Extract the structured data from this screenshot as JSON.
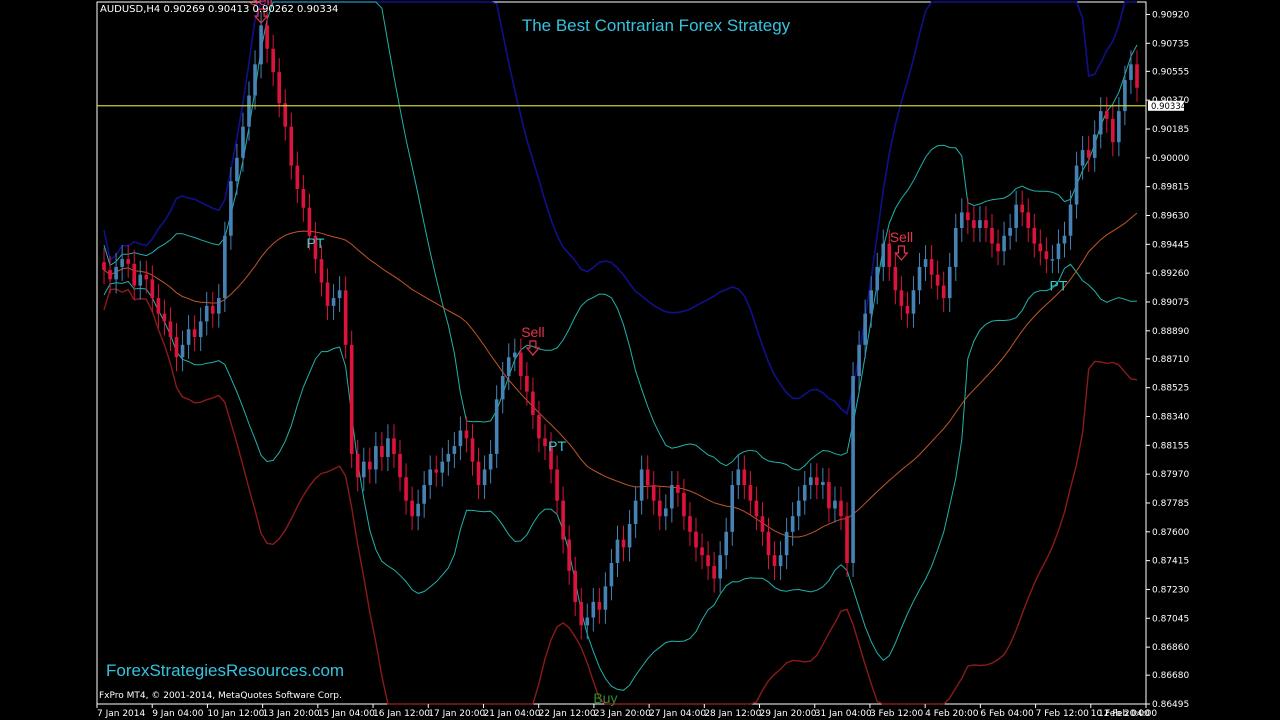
{
  "header": {
    "symbol_info": "AUDUSD,H4  0.90269 0.90413 0.90262 0.90334",
    "title": "The Best Contrarian Forex Strategy",
    "website": "ForexStrategiesResources.com",
    "copyright": "FxPro MT4, © 2001-2014, MetaQuotes Software Corp."
  },
  "colors": {
    "background": "#000000",
    "bull_candle": "#4682b4",
    "bear_candle": "#dc143c",
    "inner_band": "#20b2aa",
    "outer_band_upper": "#10108c",
    "outer_band_lower": "#8b1a1a",
    "middle_line": "#c0562a",
    "price_line": "#cccc33",
    "sell_signal": "#e8334d",
    "buy_signal": "#2e8b2e",
    "pt_label": "#30d0d0",
    "axis_text": "#ffffff"
  },
  "chart_data": {
    "type": "candlestick",
    "symbol": "AUDUSD",
    "timeframe": "H4",
    "ylim": [
      0.86495,
      0.91
    ],
    "y_ticks": [
      "0.90920",
      "0.90735",
      "0.90555",
      "0.90370",
      "0.90185",
      "0.90000",
      "0.89815",
      "0.89630",
      "0.89445",
      "0.89260",
      "0.89075",
      "0.88890",
      "0.88710",
      "0.88525",
      "0.88340",
      "0.88155",
      "0.87970",
      "0.87785",
      "0.87600",
      "0.87415",
      "0.87230",
      "0.87045",
      "0.86860",
      "0.86680",
      "0.86495"
    ],
    "current_price": "0.90334",
    "x_ticks": [
      "7 Jan 2014",
      "9 Jan 04:00",
      "10 Jan 12:00",
      "13 Jan 20:00",
      "15 Jan 04:00",
      "16 Jan 12:00",
      "17 Jan 20:00",
      "21 Jan 04:00",
      "22 Jan 12:00",
      "23 Jan 20:00",
      "27 Jan 04:00",
      "28 Jan 12:00",
      "29 Jan 20:00",
      "31 Jan 04:00",
      "3 Feb 12:00",
      "4 Feb 20:00",
      "6 Feb 04:00",
      "7 Feb 12:00",
      "10 Feb 20:00",
      "12 Feb 04:00"
    ],
    "closes": [
      0.8928,
      0.8922,
      0.893,
      0.8935,
      0.8932,
      0.8918,
      0.8925,
      0.8922,
      0.891,
      0.89,
      0.8895,
      0.8885,
      0.8872,
      0.888,
      0.889,
      0.8885,
      0.8895,
      0.8905,
      0.89,
      0.891,
      0.895,
      0.8985,
      0.9,
      0.902,
      0.904,
      0.906,
      0.9085,
      0.907,
      0.9055,
      0.9035,
      0.902,
      0.8995,
      0.898,
      0.8968,
      0.895,
      0.8935,
      0.892,
      0.8905,
      0.891,
      0.8915,
      0.888,
      0.881,
      0.8795,
      0.8805,
      0.88,
      0.8815,
      0.8808,
      0.882,
      0.881,
      0.8795,
      0.878,
      0.877,
      0.8778,
      0.879,
      0.88,
      0.8798,
      0.8805,
      0.881,
      0.8815,
      0.8825,
      0.882,
      0.8805,
      0.879,
      0.88,
      0.881,
      0.8845,
      0.886,
      0.8872,
      0.8875,
      0.886,
      0.885,
      0.8835,
      0.882,
      0.8815,
      0.88,
      0.878,
      0.8755,
      0.8735,
      0.8715,
      0.87,
      0.8705,
      0.8715,
      0.871,
      0.8725,
      0.874,
      0.8755,
      0.875,
      0.8765,
      0.878,
      0.88,
      0.879,
      0.878,
      0.877,
      0.8775,
      0.879,
      0.8785,
      0.877,
      0.876,
      0.875,
      0.8745,
      0.8738,
      0.873,
      0.8745,
      0.876,
      0.879,
      0.88,
      0.879,
      0.878,
      0.877,
      0.876,
      0.8745,
      0.8738,
      0.8745,
      0.876,
      0.877,
      0.878,
      0.879,
      0.8795,
      0.879,
      0.8792,
      0.8775,
      0.878,
      0.877,
      0.874,
      0.886,
      0.888,
      0.89,
      0.8915,
      0.893,
      0.8945,
      0.893,
      0.8915,
      0.8905,
      0.89,
      0.8915,
      0.893,
      0.8935,
      0.8925,
      0.8918,
      0.891,
      0.893,
      0.8955,
      0.8965,
      0.896,
      0.8955,
      0.896,
      0.8955,
      0.8945,
      0.894,
      0.895,
      0.8955,
      0.897,
      0.8965,
      0.8955,
      0.8945,
      0.894,
      0.8935,
      0.8935,
      0.8945,
      0.895,
      0.897,
      0.8995,
      0.9005,
      0.9,
      0.9015,
      0.903,
      0.9025,
      0.901,
      0.903,
      0.905,
      0.906,
      0.9045
    ],
    "signals": [
      {
        "label": "Sell",
        "type": "sell",
        "index": 26,
        "price": 0.9098
      },
      {
        "label": "PT",
        "type": "pt",
        "index": 35,
        "price": 0.8942
      },
      {
        "label": "Sell",
        "type": "sell",
        "index": 71,
        "price": 0.8885
      },
      {
        "label": "PT",
        "type": "pt",
        "index": 75,
        "price": 0.8812
      },
      {
        "label": "Buy",
        "type": "buy",
        "index": 83,
        "price": 0.865
      },
      {
        "label": "Sell",
        "type": "sell",
        "index": 132,
        "price": 0.8946
      },
      {
        "label": "PT",
        "type": "pt",
        "index": 158,
        "price": 0.8915
      }
    ],
    "horizontal_line": 0.90334,
    "grid": false
  }
}
